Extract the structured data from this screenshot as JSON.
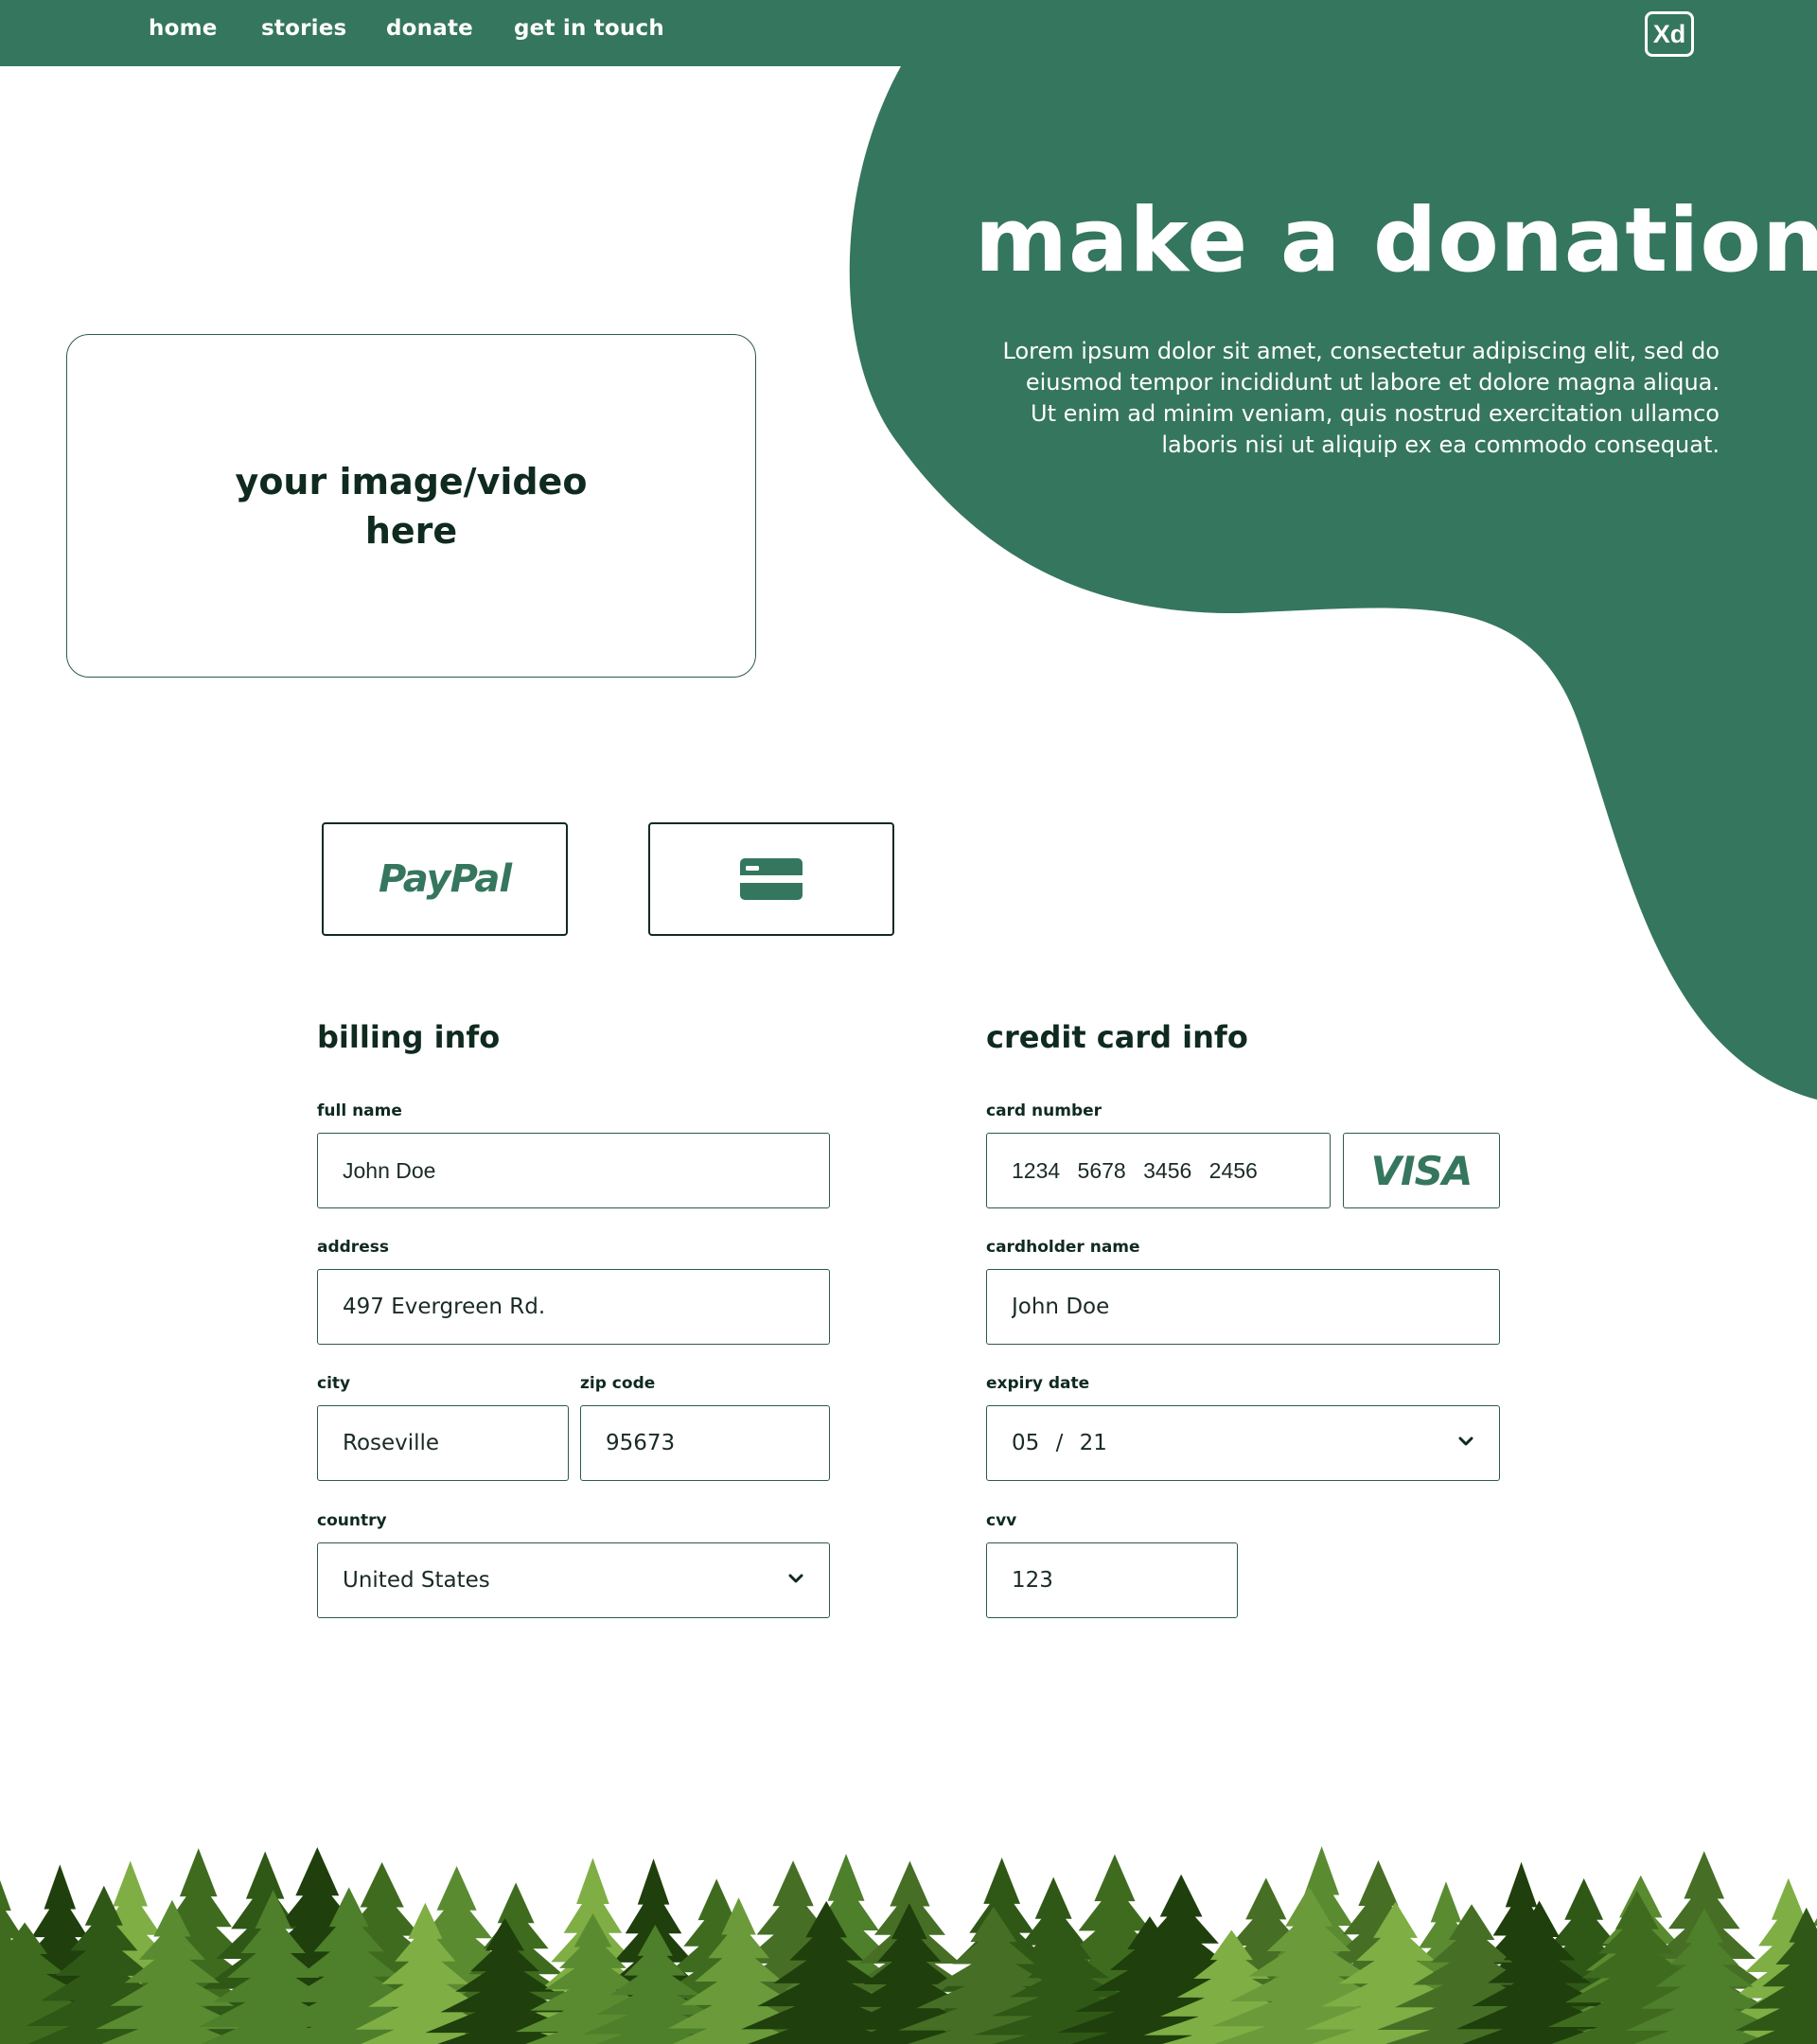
{
  "nav": {
    "links": [
      "home",
      "stories",
      "donate",
      "get in touch"
    ],
    "logo": "Xd"
  },
  "hero": {
    "title": "make a donation",
    "description": "Lorem ipsum dolor sit amet, consectetur adipiscing elit, sed do eiusmod tempor incididunt ut labore et dolore magna aliqua. Ut enim ad minim veniam, quis nostrud exercitation ullamco laboris nisi ut aliquip ex ea commodo consequat."
  },
  "media": {
    "placeholder": "your image/video here"
  },
  "payment": {
    "paypal_label": "PayPal",
    "card_icon": "credit-card-icon"
  },
  "billing": {
    "title": "billing info",
    "full_name": {
      "label": "full name",
      "value": "John Doe"
    },
    "address": {
      "label": "address",
      "value": "497 Evergreen Rd."
    },
    "city": {
      "label": "city",
      "value": "Roseville"
    },
    "zip": {
      "label": "zip code",
      "value": "95673"
    },
    "country": {
      "label": "country",
      "value": "United States"
    }
  },
  "card": {
    "title": "credit card info",
    "number": {
      "label": "card number",
      "value": "1234 5678 3456 2456"
    },
    "brand": "VISA",
    "holder": {
      "label": "cardholder name",
      "value": "John Doe"
    },
    "expiry": {
      "label": "expiry date",
      "value": "05 / 21"
    },
    "cvv": {
      "label": "cvv",
      "value": "123"
    }
  },
  "colors": {
    "brand_green": "#35765e",
    "text_dark": "#0f2a1f",
    "forest_green": "#4e7f2a"
  }
}
